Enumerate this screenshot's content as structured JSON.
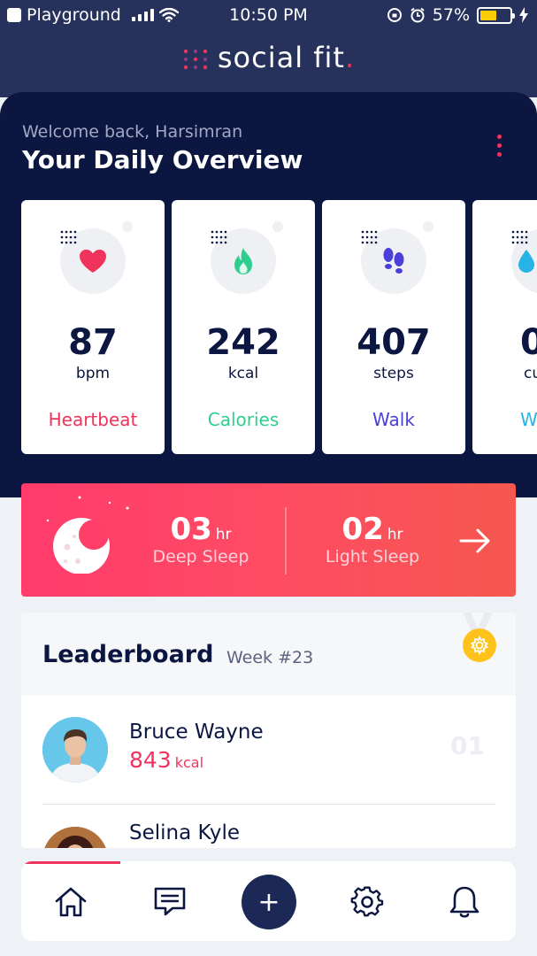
{
  "status_bar": {
    "carrier": "Playground",
    "time": "10:50 PM",
    "battery": "57%"
  },
  "logo": {
    "text": "social fit",
    "accent_dot": "."
  },
  "header": {
    "welcome": "Welcome back, Harsimran",
    "title": "Your Daily Overview"
  },
  "metrics": [
    {
      "value": "87",
      "unit": "bpm",
      "label": "Heartbeat",
      "color": "#f0335a",
      "icon": "heart-icon"
    },
    {
      "value": "242",
      "unit": "kcal",
      "label": "Calories",
      "color": "#2ecf8e",
      "icon": "flame-icon"
    },
    {
      "value": "407",
      "unit": "steps",
      "label": "Walk",
      "color": "#4a3fd8",
      "icon": "footsteps-icon"
    },
    {
      "value": "0",
      "unit": "cu",
      "label": "W",
      "color": "#27b3e6",
      "icon": "water-icon"
    }
  ],
  "sleep": {
    "deep_value": "03",
    "deep_unit": "hr",
    "deep_label": "Deep Sleep",
    "light_value": "02",
    "light_unit": "hr",
    "light_label": "Light Sleep"
  },
  "leaderboard": {
    "title": "Leaderboard",
    "week": "Week #23",
    "entries": [
      {
        "name": "Bruce Wayne",
        "kcal": "843",
        "kcal_unit": "kcal",
        "rank": "01"
      },
      {
        "name": "Selina Kyle"
      }
    ]
  },
  "tabs": [
    "home-icon",
    "chat-icon",
    "plus-icon",
    "gear-icon",
    "bell-icon"
  ],
  "fab_symbol": "+",
  "colors": {
    "navy": "#0b1641",
    "accent": "#f0335a",
    "gold": "#ffc21a"
  }
}
